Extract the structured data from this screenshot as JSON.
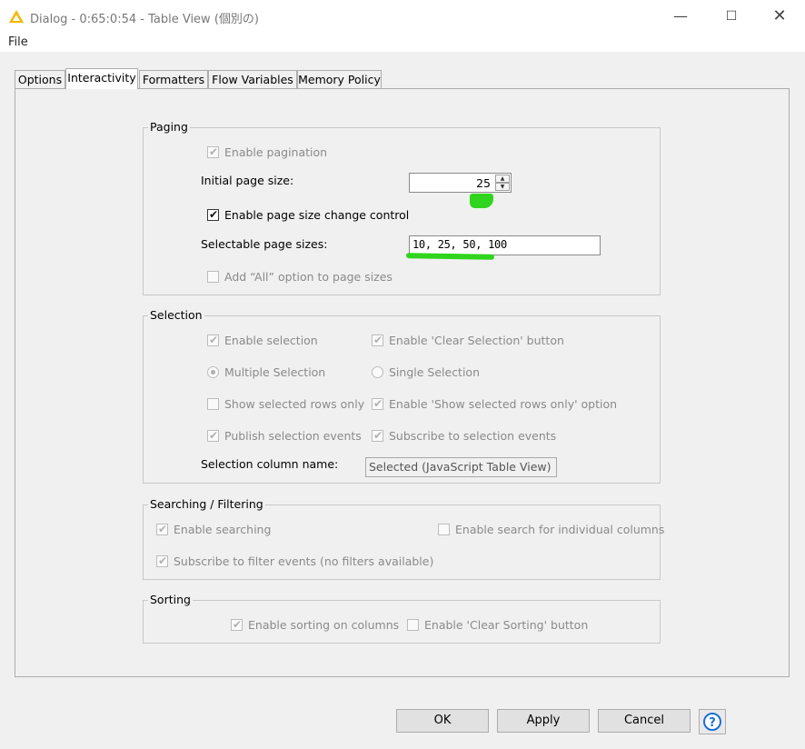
{
  "window": {
    "title": "Dialog - 0:65:0:54 - Table View (個別の)",
    "minimize_glyph": "—",
    "maximize_glyph": "☐",
    "close_glyph": "✕",
    "icon": "knime-triangle-icon"
  },
  "menu": {
    "file": "File"
  },
  "tabs": [
    {
      "label": "Options"
    },
    {
      "label": "Interactivity",
      "active": true
    },
    {
      "label": "Formatters"
    },
    {
      "label": "Flow Variables"
    },
    {
      "label": "Memory Policy"
    }
  ],
  "paging": {
    "legend": "Paging",
    "enable_pagination": "Enable pagination",
    "initial_page_size_label": "Initial page size:",
    "initial_page_size_value": "25",
    "enable_page_size_change": "Enable page size change control",
    "selectable_sizes_label": "Selectable page sizes:",
    "selectable_sizes_value": "10, 25, 50, 100",
    "add_all_option": "Add “All” option to page sizes"
  },
  "selection": {
    "legend": "Selection",
    "enable_selection": "Enable selection",
    "enable_clear_selection": "Enable 'Clear Selection' button",
    "multiple_selection": "Multiple Selection",
    "single_selection": "Single Selection",
    "show_selected_only": "Show selected rows only",
    "enable_show_selected_option": "Enable 'Show selected rows only' option",
    "publish_events": "Publish selection events",
    "subscribe_events": "Subscribe to selection events",
    "column_name_label": "Selection column name:",
    "column_name_value": "Selected (JavaScript Table View)"
  },
  "searching": {
    "legend": "Searching / Filtering",
    "enable_searching": "Enable searching",
    "enable_column_search": "Enable search for individual columns",
    "subscribe_filter": "Subscribe to filter events (no filters available)"
  },
  "sorting": {
    "legend": "Sorting",
    "enable_sorting": "Enable sorting on columns",
    "enable_clear_sorting": "Enable 'Clear Sorting' button"
  },
  "buttons": {
    "ok": "OK",
    "apply": "Apply",
    "cancel": "Cancel"
  },
  "colors": {
    "highlight": "#2fd51c",
    "window_bg": "#f0f0f0",
    "logo": "#f5b700"
  }
}
